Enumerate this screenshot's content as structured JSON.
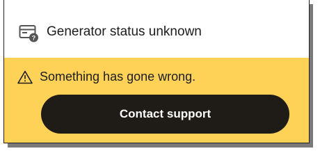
{
  "card": {
    "title": "Generator status unknown",
    "title_icon": "generator-unknown-icon"
  },
  "alert": {
    "icon": "warning-icon",
    "message": "Something has gone wrong.",
    "background": "#fdd257"
  },
  "actions": {
    "contact_support_label": "Contact support",
    "button_color": "#1f1b17"
  }
}
